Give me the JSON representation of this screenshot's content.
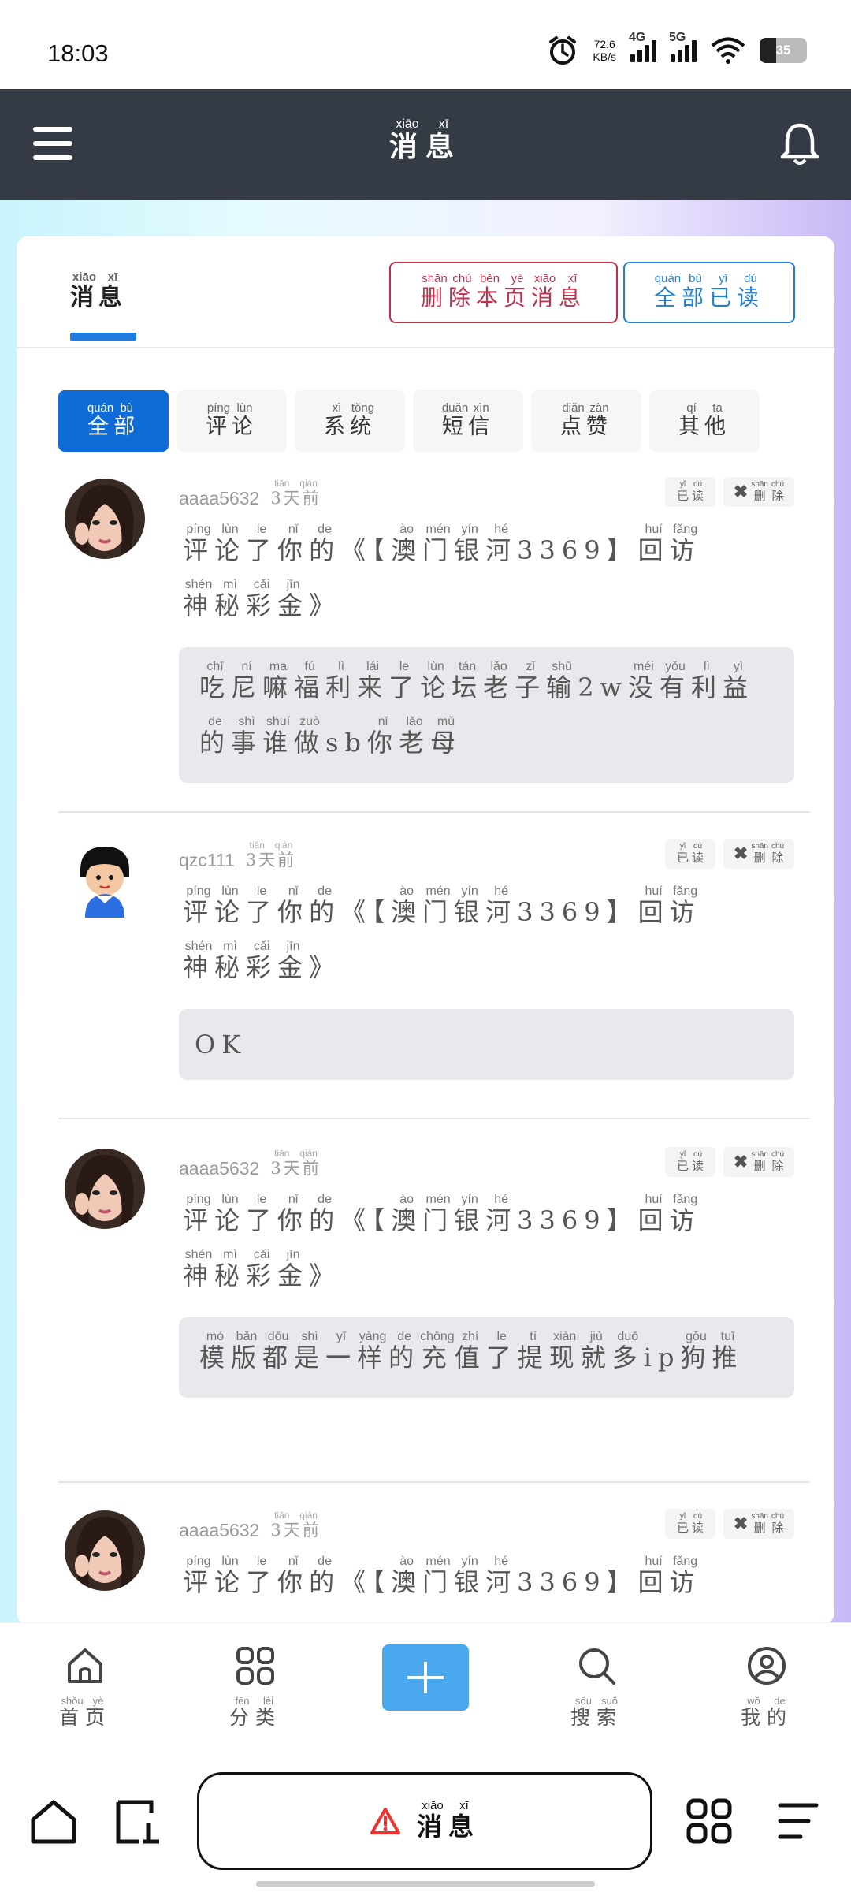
{
  "status_bar": {
    "time": "18:03",
    "net_speed": "72.6",
    "net_unit": "KB/s",
    "sig1": "4G",
    "sig2": "5G",
    "battery": "35"
  },
  "header": {
    "title": "消息",
    "title_py": [
      "xiāo",
      "xī"
    ]
  },
  "card": {
    "tab": "消息",
    "delete_page": "删除本页消息",
    "read_all": "全部已读"
  },
  "filters": [
    "全部",
    "评论",
    "系统",
    "短信",
    "点赞",
    "其他"
  ],
  "messages": [
    {
      "user": "aaaa5632",
      "ago": "3天前",
      "text_a": "评论了你的《【澳门银河3369】回访",
      "text_b": "神秘彩金》",
      "quote": "吃尼嘛福利来了论坛老子输2w没有利益的事谁做sb你老母"
    },
    {
      "user": "qzc111",
      "ago": "3天前",
      "text_a": "评论了你的《【澳门银河3369】回访",
      "text_b": "神秘彩金》",
      "quote": "OK"
    },
    {
      "user": "aaaa5632",
      "ago": "3天前",
      "text_a": "评论了你的《【澳门银河3369】回访",
      "text_b": "神秘彩金》",
      "quote": "模版都是一样的充值了提现就多ip狗推"
    },
    {
      "user": "aaaa5632",
      "ago": "3天前",
      "text_a": "评论了你的《【澳门银河3369】回访",
      "text_b": "",
      "quote": ""
    }
  ],
  "mini_buttons": {
    "read": "已读",
    "delete": "删除"
  },
  "bottom_nav": [
    {
      "label": "首页",
      "icon": "home-icon"
    },
    {
      "label": "分类",
      "icon": "grid-icon"
    },
    {
      "label": "搜索",
      "icon": "search-icon"
    },
    {
      "label": "我的",
      "icon": "user-icon"
    }
  ],
  "system_nav": {
    "pill_label": "消息",
    "pill_icon": "warning-icon"
  },
  "colors": {
    "topbar": "#353b45",
    "accent_blue": "#0f6cd6",
    "danger": "#c0304a",
    "plus": "#4aa8ef"
  }
}
